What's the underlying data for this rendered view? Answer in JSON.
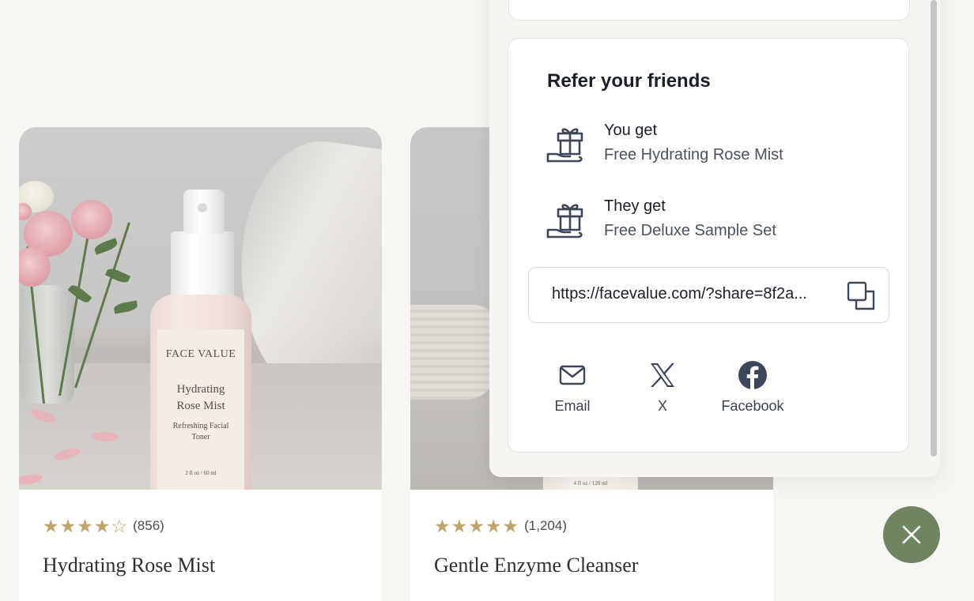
{
  "products": [
    {
      "name": "Hydrating Rose Mist",
      "rating_count": "(856)",
      "stars": [
        "★",
        "★",
        "★",
        "★",
        "☆"
      ],
      "rating_value": 4,
      "bottle_label": {
        "brand": "FACE VALUE",
        "name": "Hydrating\nRose Mist",
        "subtitle": "Refreshing Facial\nToner",
        "size": "2 fl oz / 60 ml"
      }
    },
    {
      "name": "Gentle Enzyme Cleanser",
      "rating_count": "(1,204)",
      "stars": [
        "★",
        "★",
        "★",
        "★",
        "★"
      ],
      "rating_value": 5,
      "bottle_label": {
        "size": "4 fl oz / 120 ml"
      }
    }
  ],
  "referral": {
    "title": "Refer your friends",
    "you_get_label": "You get",
    "you_get_reward": "Free Hydrating Rose Mist",
    "they_get_label": "They get",
    "they_get_reward": "Free Deluxe Sample Set",
    "share_link": "https://facevalue.com/?share=8f2a...",
    "share_options": [
      {
        "label": "Email",
        "icon": "envelope-icon"
      },
      {
        "label": "X",
        "icon": "x-logo-icon"
      },
      {
        "label": "Facebook",
        "icon": "facebook-icon"
      }
    ]
  },
  "colors": {
    "accent_green": "#6f8562",
    "star_gold": "#bea36a",
    "icon_dark": "#3c4658"
  }
}
